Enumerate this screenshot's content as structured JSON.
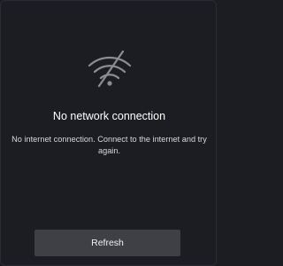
{
  "status": {
    "icon": "wifi-off-icon",
    "title": "No network connection",
    "message": "No internet connection. Connect to the internet and try again."
  },
  "actions": {
    "refresh_label": "Refresh"
  },
  "colors": {
    "background": "#1c1d22",
    "button": "#3f4046",
    "icon": "#8c8d93"
  }
}
